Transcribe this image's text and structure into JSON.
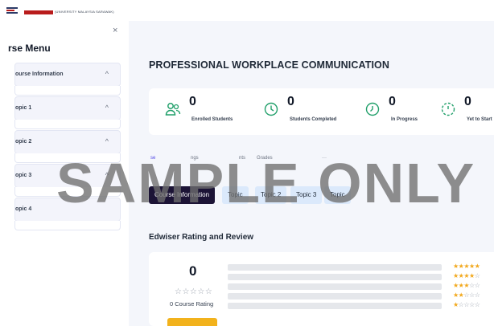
{
  "header": {
    "brand_badge_text": "",
    "brand_text": "(UNIVERSITY MALAYSIA SARAWAK)"
  },
  "sidebar": {
    "close_symbol": "×",
    "title": "rse Menu",
    "items": [
      {
        "label": "ourse Information",
        "chevron": "^"
      },
      {
        "label": "opic 1",
        "chevron": "^"
      },
      {
        "label": "opic 2",
        "chevron": "^"
      },
      {
        "label": "opic 3",
        "chevron": "^"
      },
      {
        "label": "opic 4",
        "chevron": ""
      }
    ]
  },
  "course": {
    "title": "PROFESSIONAL WORKPLACE COMMUNICATION"
  },
  "stats": [
    {
      "value": "0",
      "label": "Enrolled Students",
      "icon": "users-icon"
    },
    {
      "value": "0",
      "label": "Students Completed",
      "icon": "clock-icon"
    },
    {
      "value": "0",
      "label": "In Progress",
      "icon": "progress-clock-icon"
    },
    {
      "value": "0",
      "label": "Yet to Start",
      "icon": "timer-icon"
    }
  ],
  "tabs": [
    {
      "label": "se",
      "active": true
    },
    {
      "label": "ngs",
      "active": false
    },
    {
      "label": "nts",
      "active": false
    },
    {
      "label": "Grades",
      "active": false
    },
    {
      "label": "···",
      "active": false
    }
  ],
  "section_pills": [
    {
      "label": "Course Information",
      "active": true
    },
    {
      "label": "Topic",
      "active": false
    },
    {
      "label": "Topic 2",
      "active": false
    },
    {
      "label": "Topic 3",
      "active": false
    },
    {
      "label": "Topic",
      "active": false
    }
  ],
  "rating": {
    "title": "Edwiser Rating and Review",
    "average": "0",
    "average_stars": "☆☆☆☆☆",
    "count_label": "0 Course Rating",
    "breakdown": [
      {
        "stars": 5,
        "fraction": 0
      },
      {
        "stars": 4,
        "fraction": 0
      },
      {
        "stars": 3,
        "fraction": 0
      },
      {
        "stars": 2,
        "fraction": 0
      },
      {
        "stars": 1,
        "fraction": 0
      }
    ]
  },
  "watermark": "SAMPLE ONLY",
  "colors": {
    "accent": "#4f46e5",
    "star": "#f2a81c",
    "pill_active": "#1c1436",
    "pill": "#dbe9fb",
    "icon_green": "#22a06b"
  }
}
